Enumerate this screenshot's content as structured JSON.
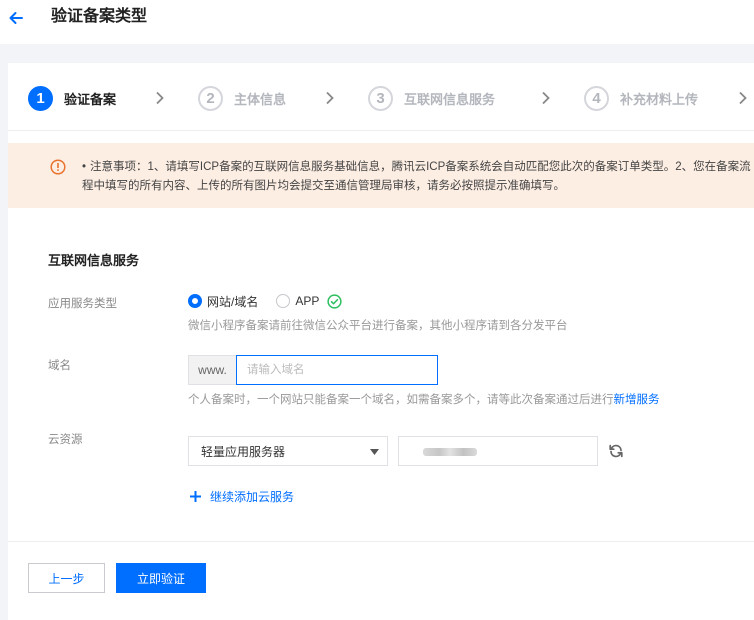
{
  "header": {
    "title": "验证备案类型"
  },
  "steps": [
    {
      "num": "1",
      "label": "验证备案"
    },
    {
      "num": "2",
      "label": "主体信息"
    },
    {
      "num": "3",
      "label": "互联网信息服务"
    },
    {
      "num": "4",
      "label": "补充材料上传"
    }
  ],
  "notice": {
    "bullet": "•",
    "text": "注意事项：1、请填写ICP备案的互联网信息服务基础信息，腾讯云ICP备案系统会自动匹配您此次的备案订单类型。2、您在备案流程中填写的所有内容、上传的所有图片均会提交至通信管理局审核，请务必按照提示准确填写。"
  },
  "section": {
    "title": "互联网信息服务",
    "service_type": {
      "label": "应用服务类型",
      "options": [
        "网站/域名",
        "APP"
      ],
      "selected": "网站/域名",
      "hint": "微信小程序备案请前往微信公众平台进行备案，其他小程序请到各分发平台"
    },
    "domain": {
      "label": "域名",
      "prefix": "www.",
      "value": "",
      "placeholder": "请输入域名",
      "hint_text": "个人备案时，一个网站只能备案一个域名，如需备案多个，请等此次备案通过后进行",
      "hint_link": "新增服务"
    },
    "cloud": {
      "label": "云资源",
      "selected": "轻量应用服务器",
      "add_label": "继续添加云服务"
    }
  },
  "footer": {
    "prev_label": "上一步",
    "verify_label": "立即验证"
  },
  "colors": {
    "accent": "#006eff",
    "notice_bg": "#fdeee4",
    "notice_icon": "#e8742f",
    "success": "#2dbe5f"
  },
  "icons": {
    "back": "arrow-left-icon",
    "chevron": "chevron-right-icon",
    "notice": "exclamation-circle-icon",
    "ok": "check-circle-icon",
    "caret": "caret-down-icon",
    "refresh": "refresh-icon",
    "add": "plus-icon"
  }
}
